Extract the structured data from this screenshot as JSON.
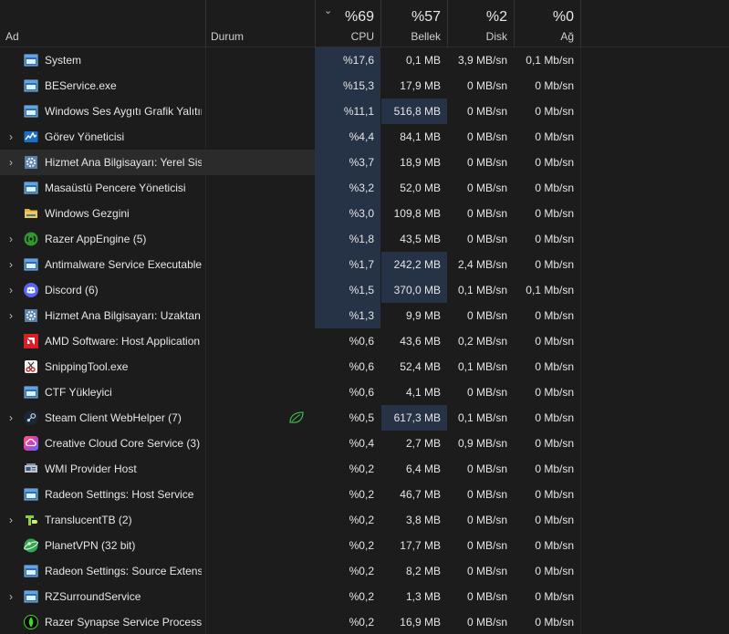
{
  "header": {
    "name_label": "Ad",
    "status_label": "Durum",
    "cpu": {
      "pct": "%69",
      "label": "CPU"
    },
    "memory": {
      "pct": "%57",
      "label": "Bellek"
    },
    "disk": {
      "pct": "%2",
      "label": "Disk"
    },
    "network": {
      "pct": "%0",
      "label": "Ağ"
    }
  },
  "colors": {
    "bg": "#1c1c1c",
    "heat_light": "#1f2a3a",
    "heat_mid": "#263246",
    "heat_strong": "#2e3a52"
  },
  "processes": [
    {
      "name": "System",
      "icon": "app-window-icon",
      "expandable": false,
      "highlight": false,
      "eco": false,
      "cpu": "%17,6",
      "mem": "0,1 MB",
      "disk": "3,9 MB/sn",
      "net": "0,1 Mb/sn",
      "heat": {
        "cpu": 2,
        "mem": 1,
        "disk": 1,
        "net": 1
      }
    },
    {
      "name": "BEService.exe",
      "icon": "app-window-icon",
      "expandable": false,
      "highlight": false,
      "eco": false,
      "cpu": "%15,3",
      "mem": "17,9 MB",
      "disk": "0 MB/sn",
      "net": "0 Mb/sn",
      "heat": {
        "cpu": 2,
        "mem": 1,
        "disk": 1,
        "net": 1
      }
    },
    {
      "name": "Windows Ses Aygıtı Grafik Yalıtımı",
      "icon": "app-window-icon",
      "expandable": false,
      "highlight": false,
      "eco": false,
      "cpu": "%11,1",
      "mem": "516,8 MB",
      "disk": "0 MB/sn",
      "net": "0 Mb/sn",
      "heat": {
        "cpu": 2,
        "mem": 2,
        "disk": 1,
        "net": 1
      }
    },
    {
      "name": "Görev Yöneticisi",
      "icon": "task-manager-icon",
      "expandable": true,
      "highlight": false,
      "eco": false,
      "cpu": "%4,4",
      "mem": "84,1 MB",
      "disk": "0 MB/sn",
      "net": "0 Mb/sn",
      "heat": {
        "cpu": 2,
        "mem": 1,
        "disk": 1,
        "net": 1
      }
    },
    {
      "name": "Hizmet Ana Bilgisayarı: Yerel Sistem",
      "icon": "gear-icon",
      "expandable": true,
      "highlight": true,
      "eco": false,
      "cpu": "%3,7",
      "mem": "18,9 MB",
      "disk": "0 MB/sn",
      "net": "0 Mb/sn",
      "heat": {
        "cpu": 2,
        "mem": 1,
        "disk": 1,
        "net": 1
      }
    },
    {
      "name": "Masaüstü Pencere Yöneticisi",
      "icon": "app-window-icon",
      "expandable": false,
      "highlight": false,
      "eco": false,
      "cpu": "%3,2",
      "mem": "52,0 MB",
      "disk": "0 MB/sn",
      "net": "0 Mb/sn",
      "heat": {
        "cpu": 2,
        "mem": 1,
        "disk": 1,
        "net": 1
      }
    },
    {
      "name": "Windows Gezgini",
      "icon": "folder-icon",
      "expandable": false,
      "highlight": false,
      "eco": false,
      "cpu": "%3,0",
      "mem": "109,8 MB",
      "disk": "0 MB/sn",
      "net": "0 Mb/sn",
      "heat": {
        "cpu": 2,
        "mem": 1,
        "disk": 1,
        "net": 1
      }
    },
    {
      "name": "Razer AppEngine (5)",
      "icon": "razer-appengine-icon",
      "expandable": true,
      "highlight": false,
      "eco": false,
      "cpu": "%1,8",
      "mem": "43,5 MB",
      "disk": "0 MB/sn",
      "net": "0 Mb/sn",
      "heat": {
        "cpu": 2,
        "mem": 1,
        "disk": 1,
        "net": 1
      }
    },
    {
      "name": "Antimalware Service Executable",
      "icon": "app-window-icon",
      "expandable": true,
      "highlight": false,
      "eco": false,
      "cpu": "%1,7",
      "mem": "242,2 MB",
      "disk": "2,4 MB/sn",
      "net": "0 Mb/sn",
      "heat": {
        "cpu": 2,
        "mem": 2,
        "disk": 1,
        "net": 1
      }
    },
    {
      "name": "Discord (6)",
      "icon": "discord-icon",
      "expandable": true,
      "highlight": false,
      "eco": false,
      "cpu": "%1,5",
      "mem": "370,0 MB",
      "disk": "0,1 MB/sn",
      "net": "0,1 Mb/sn",
      "heat": {
        "cpu": 2,
        "mem": 2,
        "disk": 1,
        "net": 1
      }
    },
    {
      "name": "Hizmet Ana Bilgisayarı: Uzaktan Yordam Çağrısı",
      "icon": "gear-icon",
      "expandable": true,
      "highlight": false,
      "eco": false,
      "cpu": "%1,3",
      "mem": "9,9 MB",
      "disk": "0 MB/sn",
      "net": "0 Mb/sn",
      "heat": {
        "cpu": 2,
        "mem": 1,
        "disk": 1,
        "net": 1
      }
    },
    {
      "name": "AMD Software: Host Application",
      "icon": "amd-icon",
      "expandable": false,
      "highlight": false,
      "eco": false,
      "cpu": "%0,6",
      "mem": "43,6 MB",
      "disk": "0,2 MB/sn",
      "net": "0 Mb/sn",
      "heat": {
        "cpu": 1,
        "mem": 1,
        "disk": 1,
        "net": 1
      }
    },
    {
      "name": "SnippingTool.exe",
      "icon": "snipping-tool-icon",
      "expandable": false,
      "highlight": false,
      "eco": false,
      "cpu": "%0,6",
      "mem": "52,4 MB",
      "disk": "0,1 MB/sn",
      "net": "0 Mb/sn",
      "heat": {
        "cpu": 1,
        "mem": 1,
        "disk": 1,
        "net": 1
      }
    },
    {
      "name": "CTF Yükleyici",
      "icon": "app-window-icon",
      "expandable": false,
      "highlight": false,
      "eco": false,
      "cpu": "%0,6",
      "mem": "4,1 MB",
      "disk": "0 MB/sn",
      "net": "0 Mb/sn",
      "heat": {
        "cpu": 1,
        "mem": 1,
        "disk": 1,
        "net": 1
      }
    },
    {
      "name": "Steam Client WebHelper (7)",
      "icon": "steam-icon",
      "expandable": true,
      "highlight": false,
      "eco": true,
      "cpu": "%0,5",
      "mem": "617,3 MB",
      "disk": "0,1 MB/sn",
      "net": "0 Mb/sn",
      "heat": {
        "cpu": 1,
        "mem": 2,
        "disk": 1,
        "net": 1
      }
    },
    {
      "name": "Creative Cloud Core Service (3)",
      "icon": "creative-cloud-icon",
      "expandable": false,
      "highlight": false,
      "eco": false,
      "cpu": "%0,4",
      "mem": "2,7 MB",
      "disk": "0,9 MB/sn",
      "net": "0 Mb/sn",
      "heat": {
        "cpu": 1,
        "mem": 1,
        "disk": 1,
        "net": 1
      }
    },
    {
      "name": "WMI Provider Host",
      "icon": "wmi-icon",
      "expandable": false,
      "highlight": false,
      "eco": false,
      "cpu": "%0,2",
      "mem": "6,4 MB",
      "disk": "0 MB/sn",
      "net": "0 Mb/sn",
      "heat": {
        "cpu": 1,
        "mem": 1,
        "disk": 1,
        "net": 1
      }
    },
    {
      "name": "Radeon Settings: Host Service",
      "icon": "app-window-icon",
      "expandable": false,
      "highlight": false,
      "eco": false,
      "cpu": "%0,2",
      "mem": "46,7 MB",
      "disk": "0 MB/sn",
      "net": "0 Mb/sn",
      "heat": {
        "cpu": 1,
        "mem": 1,
        "disk": 1,
        "net": 1
      }
    },
    {
      "name": "TranslucentTB (2)",
      "icon": "translucenttb-icon",
      "expandable": true,
      "highlight": false,
      "eco": false,
      "cpu": "%0,2",
      "mem": "3,8 MB",
      "disk": "0 MB/sn",
      "net": "0 Mb/sn",
      "heat": {
        "cpu": 1,
        "mem": 1,
        "disk": 1,
        "net": 1
      }
    },
    {
      "name": "PlanetVPN (32 bit)",
      "icon": "planetvpn-icon",
      "expandable": false,
      "highlight": false,
      "eco": false,
      "cpu": "%0,2",
      "mem": "17,7 MB",
      "disk": "0 MB/sn",
      "net": "0 Mb/sn",
      "heat": {
        "cpu": 1,
        "mem": 1,
        "disk": 1,
        "net": 1
      }
    },
    {
      "name": "Radeon Settings: Source Extension",
      "icon": "app-window-icon",
      "expandable": false,
      "highlight": false,
      "eco": false,
      "cpu": "%0,2",
      "mem": "8,2 MB",
      "disk": "0 MB/sn",
      "net": "0 Mb/sn",
      "heat": {
        "cpu": 1,
        "mem": 1,
        "disk": 1,
        "net": 1
      }
    },
    {
      "name": "RZSurroundService",
      "icon": "app-window-icon",
      "expandable": true,
      "highlight": false,
      "eco": false,
      "cpu": "%0,2",
      "mem": "1,3 MB",
      "disk": "0 MB/sn",
      "net": "0 Mb/sn",
      "heat": {
        "cpu": 1,
        "mem": 1,
        "disk": 1,
        "net": 1
      }
    },
    {
      "name": "Razer Synapse Service Process",
      "icon": "razer-synapse-icon",
      "expandable": false,
      "highlight": false,
      "eco": false,
      "cpu": "%0,2",
      "mem": "16,9 MB",
      "disk": "0 MB/sn",
      "net": "0 Mb/sn",
      "heat": {
        "cpu": 1,
        "mem": 1,
        "disk": 1,
        "net": 1
      }
    }
  ]
}
